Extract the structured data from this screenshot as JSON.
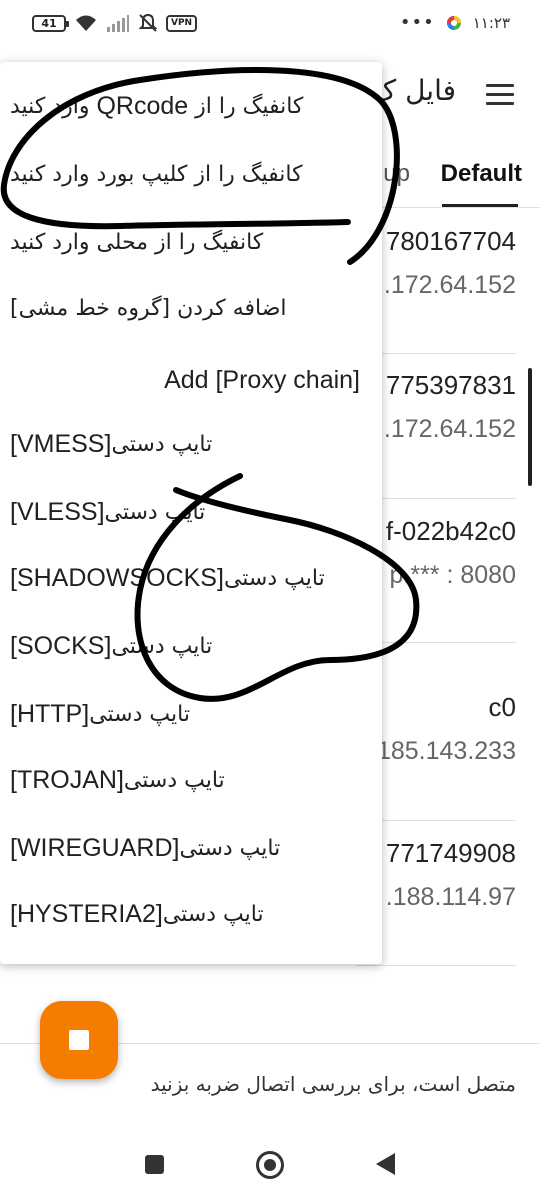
{
  "status_bar": {
    "battery": "41",
    "vpn": "VPN",
    "time": "۱۱:۲۳",
    "dots": "•••",
    "icons": [
      "battery-icon",
      "wifi-icon",
      "signal-icon",
      "notifications-off-icon",
      "vpn-icon",
      "app-notification-icon"
    ]
  },
  "app_bar": {
    "title_partial": "فایل ک",
    "tab_default": "Default",
    "tab_partial": "up"
  },
  "servers": [
    {
      "line1": "780167704",
      "line2": ".172.64.152"
    },
    {
      "line1": "775397831",
      "line2": ".172.64.152"
    },
    {
      "line1": "f-022b42c0",
      "line2": "p.*** : 8080"
    },
    {
      "line1": "c0",
      "line2": "185.143.233"
    },
    {
      "line1": "771749908",
      "line2": ".188.114.97"
    }
  ],
  "menu": {
    "items": [
      {
        "rtl": "کانفیگ را از",
        "ltr": "QRcode",
        "rtl2": "وارد کنید"
      },
      {
        "rtl": "کانفیگ را از کلیپ بورد وارد کنید"
      },
      {
        "rtl": "کانفیگ را از محلی وارد کنید"
      },
      {
        "rtl": "اضافه کردن [گروه خط مشی]"
      },
      {
        "ltr_full": "Add [Proxy chain]"
      },
      {
        "rtl": "تایپ دستی",
        "ltr": "[VMESS]"
      },
      {
        "rtl": "تایپ دستی",
        "ltr": "[VLESS]"
      },
      {
        "rtl": "تایپ دستی",
        "ltr": "[SHADOWSOCKS]"
      },
      {
        "rtl": "تایپ دستی",
        "ltr": "[SOCKS]"
      },
      {
        "rtl": "تایپ دستی",
        "ltr": "[HTTP]"
      },
      {
        "rtl": "تایپ دستی",
        "ltr": "[TROJAN]"
      },
      {
        "rtl": "تایپ دستی",
        "ltr": "[WIREGUARD]"
      },
      {
        "rtl": "تایپ دستی",
        "ltr": "[HYSTERIA2]"
      }
    ]
  },
  "bottom": {
    "status_text": "متصل است، برای بررسی اتصال ضربه بزنید"
  },
  "colors": {
    "accent": "#f57c00",
    "ink": "#000000"
  }
}
